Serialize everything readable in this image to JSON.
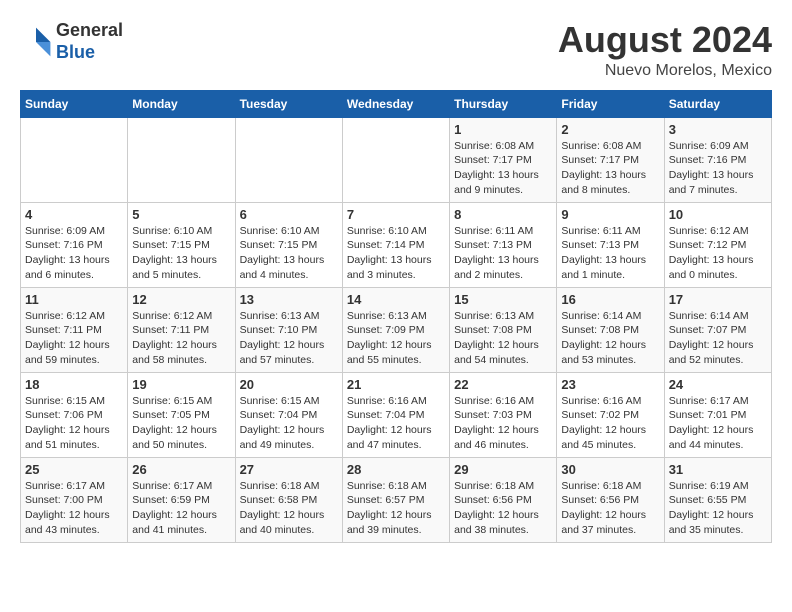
{
  "header": {
    "logo_general": "General",
    "logo_blue": "Blue",
    "month_year": "August 2024",
    "location": "Nuevo Morelos, Mexico"
  },
  "calendar": {
    "days_of_week": [
      "Sunday",
      "Monday",
      "Tuesday",
      "Wednesday",
      "Thursday",
      "Friday",
      "Saturday"
    ],
    "weeks": [
      [
        {
          "day": "",
          "info": ""
        },
        {
          "day": "",
          "info": ""
        },
        {
          "day": "",
          "info": ""
        },
        {
          "day": "",
          "info": ""
        },
        {
          "day": "1",
          "info": "Sunrise: 6:08 AM\nSunset: 7:17 PM\nDaylight: 13 hours\nand 9 minutes."
        },
        {
          "day": "2",
          "info": "Sunrise: 6:08 AM\nSunset: 7:17 PM\nDaylight: 13 hours\nand 8 minutes."
        },
        {
          "day": "3",
          "info": "Sunrise: 6:09 AM\nSunset: 7:16 PM\nDaylight: 13 hours\nand 7 minutes."
        }
      ],
      [
        {
          "day": "4",
          "info": "Sunrise: 6:09 AM\nSunset: 7:16 PM\nDaylight: 13 hours\nand 6 minutes."
        },
        {
          "day": "5",
          "info": "Sunrise: 6:10 AM\nSunset: 7:15 PM\nDaylight: 13 hours\nand 5 minutes."
        },
        {
          "day": "6",
          "info": "Sunrise: 6:10 AM\nSunset: 7:15 PM\nDaylight: 13 hours\nand 4 minutes."
        },
        {
          "day": "7",
          "info": "Sunrise: 6:10 AM\nSunset: 7:14 PM\nDaylight: 13 hours\nand 3 minutes."
        },
        {
          "day": "8",
          "info": "Sunrise: 6:11 AM\nSunset: 7:13 PM\nDaylight: 13 hours\nand 2 minutes."
        },
        {
          "day": "9",
          "info": "Sunrise: 6:11 AM\nSunset: 7:13 PM\nDaylight: 13 hours\nand 1 minute."
        },
        {
          "day": "10",
          "info": "Sunrise: 6:12 AM\nSunset: 7:12 PM\nDaylight: 13 hours\nand 0 minutes."
        }
      ],
      [
        {
          "day": "11",
          "info": "Sunrise: 6:12 AM\nSunset: 7:11 PM\nDaylight: 12 hours\nand 59 minutes."
        },
        {
          "day": "12",
          "info": "Sunrise: 6:12 AM\nSunset: 7:11 PM\nDaylight: 12 hours\nand 58 minutes."
        },
        {
          "day": "13",
          "info": "Sunrise: 6:13 AM\nSunset: 7:10 PM\nDaylight: 12 hours\nand 57 minutes."
        },
        {
          "day": "14",
          "info": "Sunrise: 6:13 AM\nSunset: 7:09 PM\nDaylight: 12 hours\nand 55 minutes."
        },
        {
          "day": "15",
          "info": "Sunrise: 6:13 AM\nSunset: 7:08 PM\nDaylight: 12 hours\nand 54 minutes."
        },
        {
          "day": "16",
          "info": "Sunrise: 6:14 AM\nSunset: 7:08 PM\nDaylight: 12 hours\nand 53 minutes."
        },
        {
          "day": "17",
          "info": "Sunrise: 6:14 AM\nSunset: 7:07 PM\nDaylight: 12 hours\nand 52 minutes."
        }
      ],
      [
        {
          "day": "18",
          "info": "Sunrise: 6:15 AM\nSunset: 7:06 PM\nDaylight: 12 hours\nand 51 minutes."
        },
        {
          "day": "19",
          "info": "Sunrise: 6:15 AM\nSunset: 7:05 PM\nDaylight: 12 hours\nand 50 minutes."
        },
        {
          "day": "20",
          "info": "Sunrise: 6:15 AM\nSunset: 7:04 PM\nDaylight: 12 hours\nand 49 minutes."
        },
        {
          "day": "21",
          "info": "Sunrise: 6:16 AM\nSunset: 7:04 PM\nDaylight: 12 hours\nand 47 minutes."
        },
        {
          "day": "22",
          "info": "Sunrise: 6:16 AM\nSunset: 7:03 PM\nDaylight: 12 hours\nand 46 minutes."
        },
        {
          "day": "23",
          "info": "Sunrise: 6:16 AM\nSunset: 7:02 PM\nDaylight: 12 hours\nand 45 minutes."
        },
        {
          "day": "24",
          "info": "Sunrise: 6:17 AM\nSunset: 7:01 PM\nDaylight: 12 hours\nand 44 minutes."
        }
      ],
      [
        {
          "day": "25",
          "info": "Sunrise: 6:17 AM\nSunset: 7:00 PM\nDaylight: 12 hours\nand 43 minutes."
        },
        {
          "day": "26",
          "info": "Sunrise: 6:17 AM\nSunset: 6:59 PM\nDaylight: 12 hours\nand 41 minutes."
        },
        {
          "day": "27",
          "info": "Sunrise: 6:18 AM\nSunset: 6:58 PM\nDaylight: 12 hours\nand 40 minutes."
        },
        {
          "day": "28",
          "info": "Sunrise: 6:18 AM\nSunset: 6:57 PM\nDaylight: 12 hours\nand 39 minutes."
        },
        {
          "day": "29",
          "info": "Sunrise: 6:18 AM\nSunset: 6:56 PM\nDaylight: 12 hours\nand 38 minutes."
        },
        {
          "day": "30",
          "info": "Sunrise: 6:18 AM\nSunset: 6:56 PM\nDaylight: 12 hours\nand 37 minutes."
        },
        {
          "day": "31",
          "info": "Sunrise: 6:19 AM\nSunset: 6:55 PM\nDaylight: 12 hours\nand 35 minutes."
        }
      ]
    ]
  }
}
